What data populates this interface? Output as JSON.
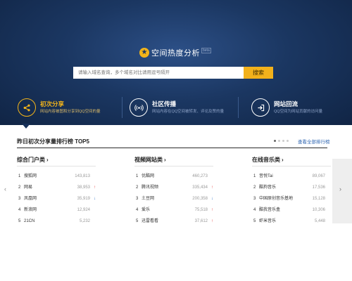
{
  "hero": {
    "brand_icon": "star-icon",
    "title": "空间热度分析",
    "beta": "beta",
    "search_placeholder": "请输入域名查询，多个域名对比请用逗号隔开",
    "search_button": "搜索"
  },
  "features": [
    {
      "title": "初次分享",
      "desc": "网站内容被图和分享到QQ空间的量",
      "icon": "share-icon",
      "active": true
    },
    {
      "title": "社区传播",
      "desc": "网站内容在QQ空间被转发、评论及赞的量",
      "icon": "broadcast-icon",
      "active": false
    },
    {
      "title": "网站回流",
      "desc": "QQ空间为网站贡献的访问量",
      "icon": "return-icon",
      "active": false
    }
  ],
  "panel": {
    "title": "昨日初次分享量排行榜 TOP5",
    "more": "查看全部排行榜"
  },
  "columns": [
    {
      "title": "综合门户类",
      "rows": [
        {
          "rank": "1",
          "name": "搜狐网",
          "value": "143,813",
          "trend": ""
        },
        {
          "rank": "2",
          "name": "网易",
          "value": "38,953",
          "trend": "up"
        },
        {
          "rank": "3",
          "name": "凤凰网",
          "value": "35,919",
          "trend": "down"
        },
        {
          "rank": "4",
          "name": "新浪网",
          "value": "12,924",
          "trend": ""
        },
        {
          "rank": "5",
          "name": "21CN",
          "value": "5,232",
          "trend": ""
        }
      ]
    },
    {
      "title": "视频网站类",
      "rows": [
        {
          "rank": "1",
          "name": "优酷网",
          "value": "460,273",
          "trend": ""
        },
        {
          "rank": "2",
          "name": "腾讯视频",
          "value": "335,434",
          "trend": "up"
        },
        {
          "rank": "3",
          "name": "土豆网",
          "value": "200,358",
          "trend": "down"
        },
        {
          "rank": "4",
          "name": "爱乐",
          "value": "75,518",
          "trend": "up"
        },
        {
          "rank": "5",
          "name": "迅雷看看",
          "value": "37,612",
          "trend": "up"
        }
      ]
    },
    {
      "title": "在线音乐类",
      "rows": [
        {
          "rank": "1",
          "name": "音悦Tai",
          "value": "89,067",
          "trend": ""
        },
        {
          "rank": "2",
          "name": "酷狗音乐",
          "value": "17,536",
          "trend": ""
        },
        {
          "rank": "3",
          "name": "中国原创音乐基地",
          "value": "15,128",
          "trend": ""
        },
        {
          "rank": "4",
          "name": "酷我音乐盒",
          "value": "10,306",
          "trend": ""
        },
        {
          "rank": "5",
          "name": "虾米音乐",
          "value": "5,448",
          "trend": ""
        }
      ]
    }
  ],
  "nav": {
    "prev": "‹",
    "next": "›"
  },
  "chevron": "›",
  "colors": {
    "accent": "#f3b41a",
    "up": "#e23b3b",
    "down": "#2d72c9",
    "hero": "#1b3762"
  }
}
